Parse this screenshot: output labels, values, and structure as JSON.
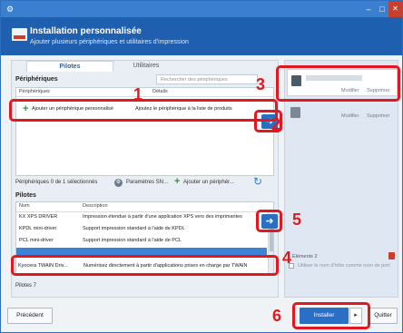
{
  "window": {
    "app_icon": "gear-icon",
    "minimize_glyph": "–",
    "maximize_glyph": "□",
    "close_glyph": "✕"
  },
  "header": {
    "title": "Installation personnalisée",
    "subtitle": "Ajouter plusieurs périphériques et utilitaires d'impression"
  },
  "tabs": [
    {
      "label": "Pilotes"
    },
    {
      "label": "Utilitaires"
    }
  ],
  "devices": {
    "section_label": "Périphériques",
    "search_placeholder": "Rechercher des périphériques",
    "columns": [
      "Périphériques",
      "Détails"
    ],
    "add_row": {
      "name": "Ajouter un périphérique personnalisé",
      "detail": "Ajoutez le périphérique à la liste de produits"
    },
    "selection_count": "Périphériques 0 de 1 sélectionnés",
    "settings_label": "Paramètres SN...",
    "add_device_label": "Ajouter un périphér..."
  },
  "drivers": {
    "section_label": "Pilotes",
    "columns": [
      "Nom",
      "Description"
    ],
    "rows": [
      {
        "name": "KX XPS DRIVER",
        "description": "Impression étendue à partir d'une application XPS vers des imprimantes"
      },
      {
        "name": "KPDL mini-driver",
        "description": "Support impression standard à l'aide de KPDL"
      },
      {
        "name": "PCL mini-driver",
        "description": "Support impression standard à l'aide de PCL"
      },
      {
        "name": "",
        "description": ""
      },
      {
        "name": "Kyocera TWAIN Driv...",
        "description": "Numérisez directement à partir d'applications prises en charge par TWAIN"
      }
    ],
    "count_label": "Pilotes 7"
  },
  "selected": {
    "modify_link": "Modifier",
    "remove_link": "Supprimer",
    "elements_label": "Éléments 2",
    "host_option": "Utiliser le nom d'hôte comme nom de port"
  },
  "footer": {
    "previous_label": "Précédent",
    "install_label": "Installer",
    "install_arrow": "▸",
    "quit_label": "Quitter"
  },
  "icons": {
    "arrow": "➜",
    "plus": "+",
    "refresh": "↻",
    "gear": "⚙"
  },
  "callouts": [
    "1",
    "2",
    "3",
    "4",
    "5",
    "6"
  ],
  "accent_color": "#e0181f",
  "brand_color": "#1f5fb0"
}
